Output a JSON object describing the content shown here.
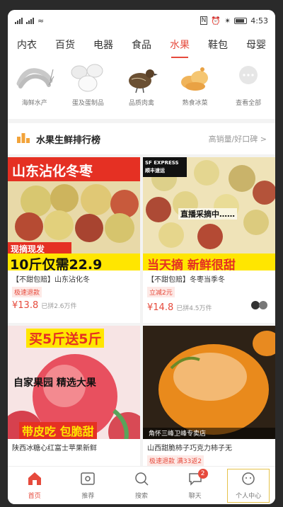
{
  "status": {
    "time": "4:53"
  },
  "categories": [
    "内衣",
    "百货",
    "电器",
    "食品",
    "水果",
    "鞋包",
    "母婴"
  ],
  "subcategories": [
    {
      "label": "海鲜水产",
      "icon": "shrimp-icon"
    },
    {
      "label": "蛋及蛋制品",
      "icon": "eggs-icon"
    },
    {
      "label": "品质肉禽",
      "icon": "quail-icon"
    },
    {
      "label": "熟食冰菜",
      "icon": "snacks-icon"
    },
    {
      "label": "查看全部",
      "icon": "more-icon"
    }
  ],
  "ranking": {
    "title": "水果生鲜排行榜",
    "more": "高销量/好口碑 >"
  },
  "products": [
    {
      "banner_top": "山东沾化冬枣",
      "banner_mid": "现摘现发",
      "banner_bottom": "10斤仅需22.9",
      "name": "【不甜包赔】山东沾化冬",
      "tag": "极速退款",
      "price": "¥13.8",
      "sold": "已拼2.6万件"
    },
    {
      "banner_top": "SF EXPRESS 顺丰速运",
      "banner_mid": "直播采摘中……",
      "banner_bottom": "当天摘 新鲜很甜",
      "name": "【不甜包赔】冬枣当季冬",
      "tag": "立减2元",
      "price": "¥14.8",
      "sold": "已拼4.5万件"
    },
    {
      "banner_top": "买5斤送5斤",
      "banner_mid": "自家果园  精选大果",
      "banner_bottom": "带皮吃  包脆甜",
      "name": "陕西冰糖心红富士苹果新鲜",
      "tag": "",
      "price": "",
      "sold": ""
    },
    {
      "banner_top": "",
      "banner_mid": "",
      "banner_bottom": "角怀三峰卫峰专卖店",
      "name": "山西甜脆柿子巧克力柿子无",
      "tag": "极速退款  满33返2",
      "price": "",
      "sold": ""
    }
  ],
  "bottom_nav": [
    {
      "label": "首页",
      "icon": "home-icon"
    },
    {
      "label": "推荐",
      "icon": "recommend-icon"
    },
    {
      "label": "搜索",
      "icon": "search-icon"
    },
    {
      "label": "聊天",
      "icon": "chat-icon",
      "badge": "2"
    },
    {
      "label": "个人中心",
      "icon": "profile-icon"
    }
  ],
  "colors": {
    "accent": "#e64a3c",
    "banner_red": "#e53023",
    "banner_yellow": "#ffe600"
  }
}
